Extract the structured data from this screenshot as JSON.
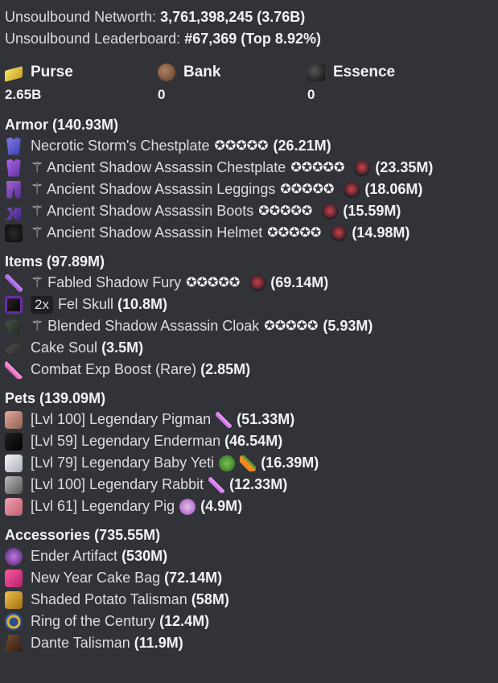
{
  "summary": {
    "networth_label": "Unsoulbound Networth:",
    "networth_value": "3,761,398,245",
    "networth_short": "(3.76B)",
    "leaderboard_label": "Unsoulbound Leaderboard:",
    "leaderboard_rank": "#67,369",
    "leaderboard_top": "(Top 8.92%)"
  },
  "balances": [
    {
      "label": "Purse",
      "value": "2.65B",
      "icon": "gold-ingot-icon"
    },
    {
      "label": "Bank",
      "value": "0",
      "icon": "bank-icon"
    },
    {
      "label": "Essence",
      "value": "0",
      "icon": "essence-icon"
    }
  ],
  "sections": {
    "armor": {
      "title": "Armor (140.93M)",
      "items": [
        {
          "name": "Necrotic Storm's Chestplate",
          "stars": "✪✪✪✪✪",
          "value": "(26.21M)"
        },
        {
          "name": "⚚ Ancient Shadow Assassin Chestplate",
          "stars": "✪✪✪✪✪",
          "value": "(23.35M)"
        },
        {
          "name": "⚚ Ancient Shadow Assassin Leggings",
          "stars": "✪✪✪✪✪",
          "value": "(18.06M)"
        },
        {
          "name": "⚚ Ancient Shadow Assassin Boots",
          "stars": "✪✪✪✪✪",
          "value": "(15.59M)"
        },
        {
          "name": "⚚ Ancient Shadow Assassin Helmet",
          "stars": "✪✪✪✪✪",
          "value": "(14.98M)"
        }
      ]
    },
    "items": {
      "title": "Items (97.89M)",
      "list": [
        {
          "name": "⚚ Fabled Shadow Fury",
          "stars": "✪✪✪✪✪",
          "value": "(69.14M)"
        },
        {
          "badge": "2x",
          "name": "Fel Skull",
          "value": "(10.8M)"
        },
        {
          "name": "⚚ Blended Shadow Assassin Cloak",
          "stars": "✪✪✪✪✪",
          "value": "(5.93M)"
        },
        {
          "name": "Cake Soul",
          "value": "(3.5M)"
        },
        {
          "name": "Combat Exp Boost (Rare)",
          "value": "(2.85M)"
        }
      ]
    },
    "pets": {
      "title": "Pets (139.09M)",
      "list": [
        {
          "name": "[Lvl 100] Legendary Pigman",
          "value": "(51.33M)"
        },
        {
          "name": "[Lvl 59] Legendary Enderman",
          "value": "(46.54M)"
        },
        {
          "name": "[Lvl 79] Legendary Baby Yeti",
          "value": "(16.39M)"
        },
        {
          "name": "[Lvl 100] Legendary Rabbit",
          "value": "(12.33M)"
        },
        {
          "name": "[Lvl 61] Legendary Pig",
          "value": "(4.9M)"
        }
      ]
    },
    "accessories": {
      "title": "Accessories (735.55M)",
      "list": [
        {
          "name": "Ender Artifact",
          "value": "(530M)"
        },
        {
          "name": "New Year Cake Bag",
          "value": "(72.14M)"
        },
        {
          "name": "Shaded Potato Talisman",
          "value": "(58M)"
        },
        {
          "name": "Ring of the Century",
          "value": "(12.4M)"
        },
        {
          "name": "Dante Talisman",
          "value": "(11.9M)"
        }
      ]
    }
  }
}
